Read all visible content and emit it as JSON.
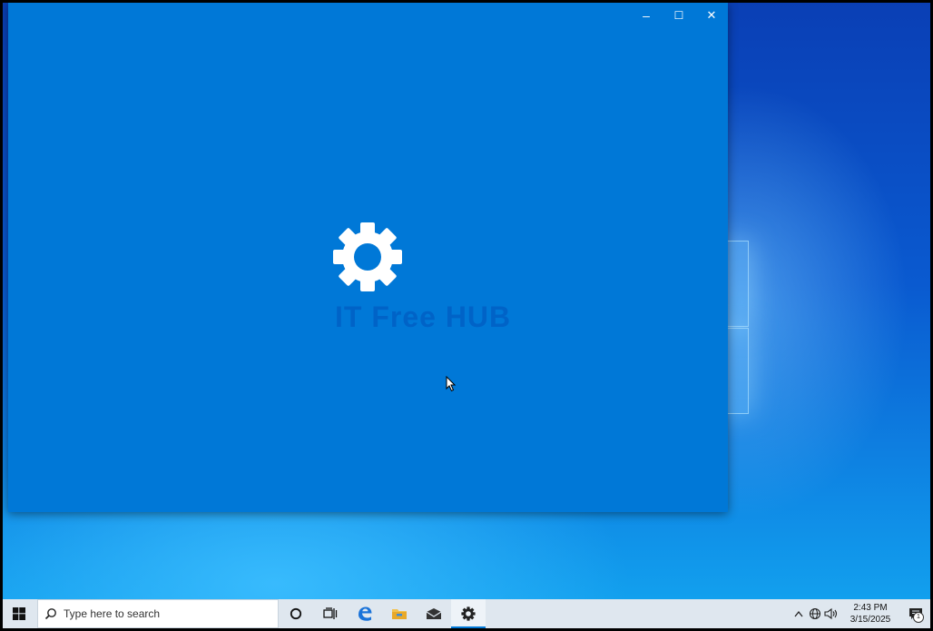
{
  "app_window": {
    "minimize_symbol": "–",
    "maximize_symbol": "☐",
    "close_symbol": "✕",
    "background_color": "#0078d7",
    "splash_icon": "gear-icon",
    "watermark_text": "IT Free HUB"
  },
  "taskbar": {
    "search_placeholder": "Type here to search",
    "pinned": [
      {
        "name": "cortana",
        "icon": "circle-icon"
      },
      {
        "name": "task-view",
        "icon": "task-view-icon"
      },
      {
        "name": "edge",
        "icon": "edge-icon"
      },
      {
        "name": "file-explorer",
        "icon": "folder-icon"
      },
      {
        "name": "mail",
        "icon": "mail-icon"
      },
      {
        "name": "settings",
        "icon": "gear-icon",
        "active": true
      }
    ],
    "tray": {
      "chevron": "^",
      "time": "2:43 PM",
      "date": "3/15/2025",
      "notification_count": "1"
    }
  },
  "colors": {
    "accent": "#0078d7",
    "taskbar": "#dfe7ef"
  }
}
